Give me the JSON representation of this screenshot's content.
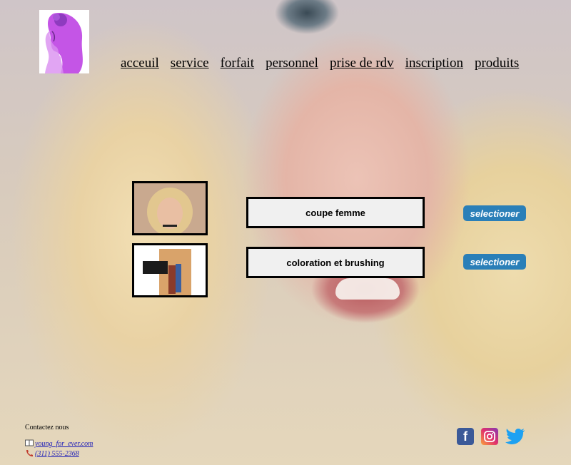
{
  "nav": {
    "items": [
      "acceuil",
      "service",
      "forfait",
      "personnel",
      "prise de rdv",
      "inscription",
      "produits"
    ]
  },
  "services": [
    {
      "name": "coupe femme",
      "button": "selectioner"
    },
    {
      "name": "coloration et brushing",
      "button": "selectioner"
    }
  ],
  "contact": {
    "title": "Contactez nous",
    "email": "young_for_ever.com",
    "phone": "(311) 555-2368",
    "email_icon": "book-icon",
    "phone_icon": "phone-icon"
  },
  "social": {
    "facebook_icon": "facebook-icon",
    "instagram_icon": "instagram-icon",
    "twitter_icon": "twitter-icon",
    "facebook_color": "#3b5998",
    "twitter_color": "#1da1f2"
  }
}
